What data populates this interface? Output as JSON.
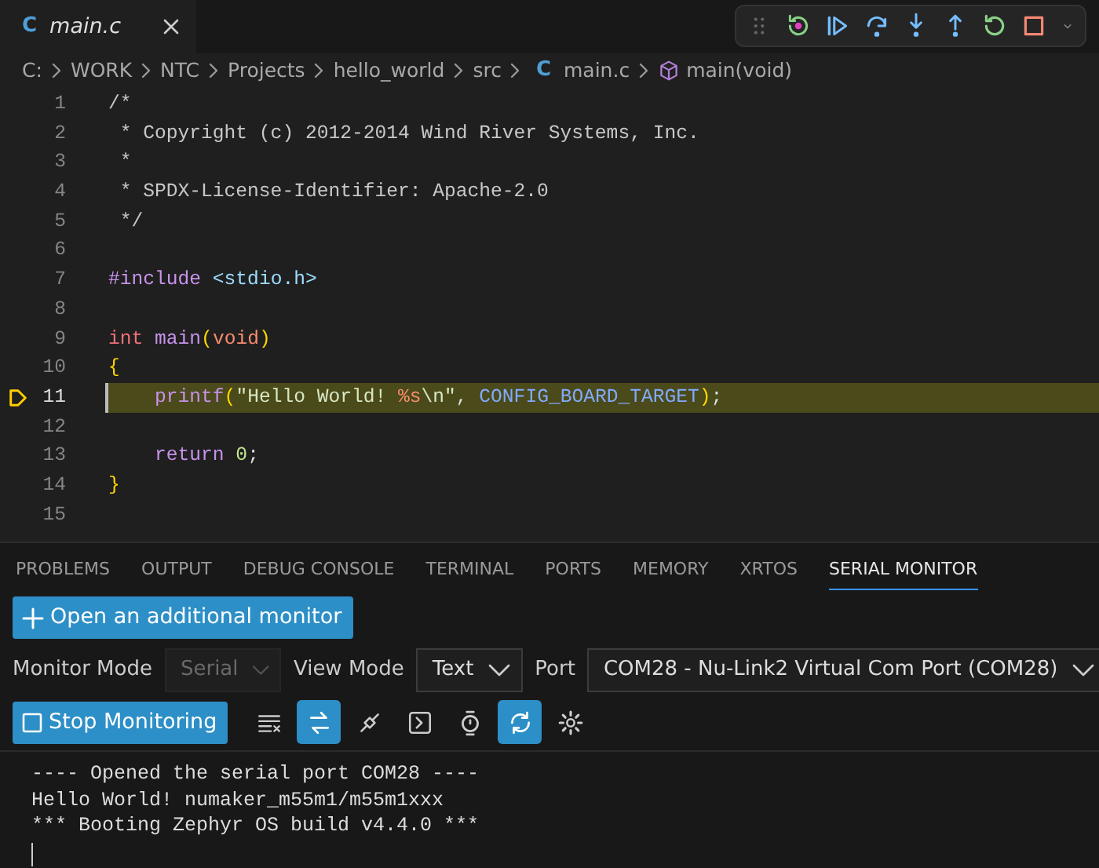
{
  "editor_tabs": [
    {
      "icon_text": "C",
      "label": "main.c",
      "selected": true
    }
  ],
  "breadcrumb": [
    {
      "kind": "folder",
      "text": "C:"
    },
    {
      "kind": "folder",
      "text": "WORK"
    },
    {
      "kind": "folder",
      "text": "NTC"
    },
    {
      "kind": "folder",
      "text": "Projects"
    },
    {
      "kind": "folder",
      "text": "hello_world"
    },
    {
      "kind": "folder",
      "text": "src"
    },
    {
      "kind": "file",
      "icon_text": "C",
      "text": "main.c"
    },
    {
      "kind": "symbol",
      "text": "main(void)"
    }
  ],
  "code_lines": [
    {
      "number": "1",
      "current": false,
      "tokens": [
        {
          "kind": "comment",
          "text": "/*"
        }
      ]
    },
    {
      "number": "2",
      "current": false,
      "tokens": [
        {
          "kind": "comment",
          "text": " * Copyright (c) 2012-2014 Wind River Systems, Inc."
        }
      ]
    },
    {
      "number": "3",
      "current": false,
      "tokens": [
        {
          "kind": "comment",
          "text": " *"
        }
      ]
    },
    {
      "number": "4",
      "current": false,
      "tokens": [
        {
          "kind": "comment",
          "text": " * SPDX-License-Identifier: Apache-2.0"
        }
      ]
    },
    {
      "number": "5",
      "current": false,
      "tokens": [
        {
          "kind": "comment",
          "text": " */"
        }
      ]
    },
    {
      "number": "6",
      "current": false
    },
    {
      "number": "7",
      "current": false,
      "tokens": [
        {
          "kind": "directive",
          "text": "#include"
        },
        {
          "kind": "header",
          "text": "<stdio.h>",
          "space_before": true
        }
      ]
    },
    {
      "number": "8",
      "current": false
    },
    {
      "number": "9",
      "current": false,
      "tokens": [
        {
          "kind": "type",
          "text": "int"
        },
        {
          "kind": "function",
          "text": "main",
          "space_before": true
        },
        {
          "kind": "bracket",
          "text": "("
        },
        {
          "kind": "param",
          "text": "void"
        },
        {
          "kind": "bracket",
          "text": ")"
        }
      ]
    },
    {
      "number": "10",
      "current": false,
      "tokens": [
        {
          "kind": "bracket",
          "text": "{"
        }
      ]
    },
    {
      "number": "11",
      "current": true,
      "indented": true,
      "tokens": [
        {
          "kind": "function",
          "text": "printf"
        },
        {
          "kind": "bracket",
          "text": "("
        },
        {
          "kind": "string",
          "text": "\"Hello World!"
        },
        {
          "kind": "format",
          "text": "%s",
          "space_before": true
        },
        {
          "kind": "string",
          "text": "\\n\""
        },
        {
          "kind": "plain",
          "text": ","
        },
        {
          "kind": "macro",
          "text": "CONFIG_BOARD_TARGET",
          "space_before": true
        },
        {
          "kind": "bracket",
          "text": ")"
        },
        {
          "kind": "plain",
          "text": ";"
        }
      ]
    },
    {
      "number": "12",
      "current": false
    },
    {
      "number": "13",
      "current": false,
      "indented": true,
      "tokens": [
        {
          "kind": "keyword",
          "text": "return"
        },
        {
          "kind": "number",
          "text": "0",
          "space_before": true
        },
        {
          "kind": "plain",
          "text": ";"
        }
      ]
    },
    {
      "number": "14",
      "current": false,
      "tokens": [
        {
          "kind": "bracket",
          "text": "}"
        }
      ]
    },
    {
      "number": "15",
      "current": false
    }
  ],
  "panel_tabs": [
    {
      "label": "PROBLEMS",
      "selected": false
    },
    {
      "label": "OUTPUT",
      "selected": false
    },
    {
      "label": "DEBUG CONSOLE",
      "selected": false
    },
    {
      "label": "TERMINAL",
      "selected": false
    },
    {
      "label": "PORTS",
      "selected": false
    },
    {
      "label": "MEMORY",
      "selected": false
    },
    {
      "label": "XRTOS",
      "selected": false
    },
    {
      "label": "SERIAL MONITOR",
      "selected": true
    }
  ],
  "open_monitor_button": "Open an additional monitor",
  "monitor_mode": {
    "label": "Monitor Mode",
    "value": "Serial",
    "disabled": true
  },
  "view_mode": {
    "label": "View Mode",
    "value": "Text",
    "disabled": false
  },
  "port": {
    "label": "Port",
    "value": "COM28 - Nu-Link2 Virtual Com Port (COM28)",
    "disabled": false
  },
  "stop_button": "Stop Monitoring",
  "monitor_tools": [
    {
      "kind": "clear",
      "on": false
    },
    {
      "kind": "swap",
      "on": true
    },
    {
      "kind": "plug",
      "on": false
    },
    {
      "kind": "terminal",
      "on": false
    },
    {
      "kind": "timer",
      "on": false
    },
    {
      "kind": "autoscroll",
      "on": true
    },
    {
      "kind": "settings",
      "on": false
    }
  ],
  "output_lines": [
    "---- Opened the serial port COM28 ----",
    "Hello World! numaker_m55m1/m55m1xxx",
    "*** Booting Zephyr OS build v4.4.0 ***"
  ]
}
